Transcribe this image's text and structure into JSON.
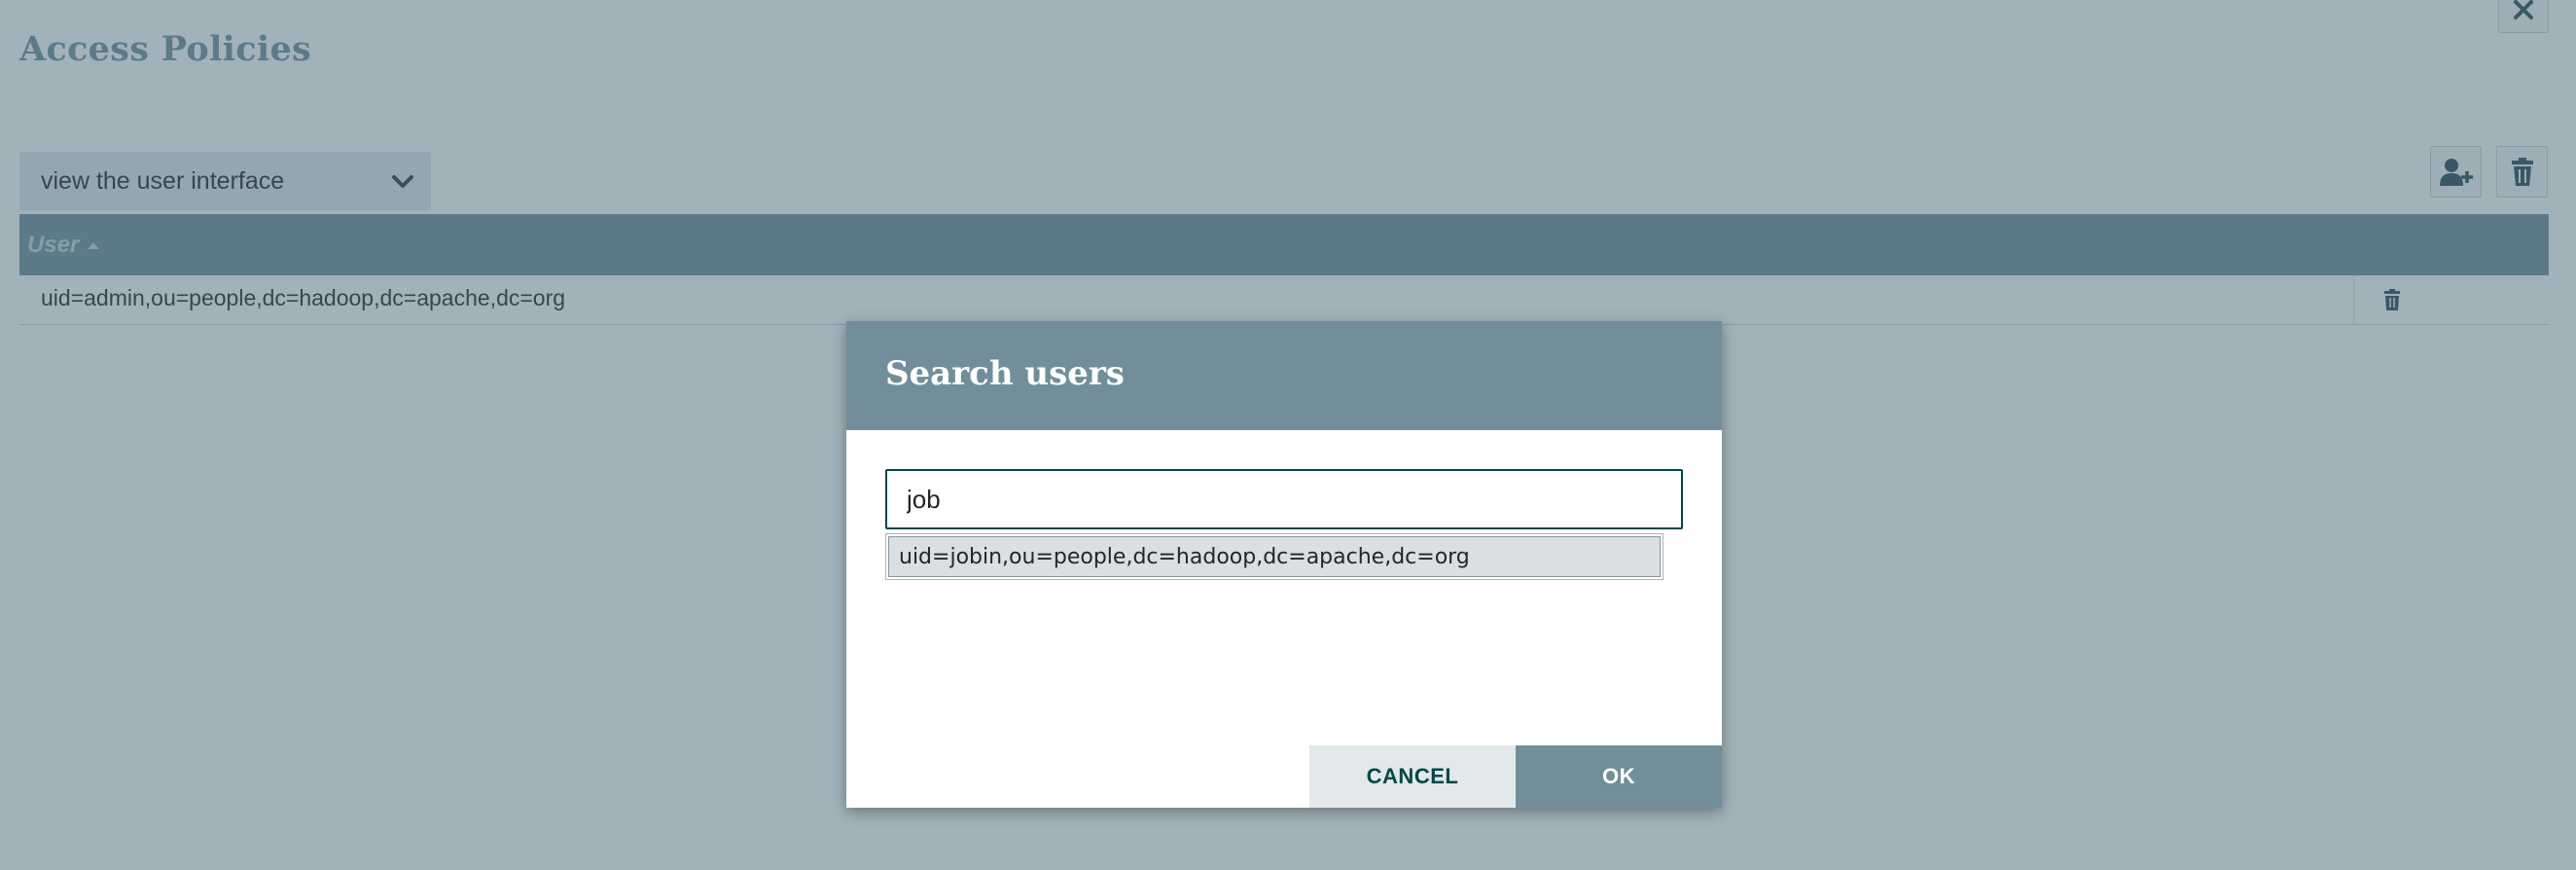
{
  "page": {
    "title": "Access Policies",
    "policy_select": {
      "selected": "view the user interface"
    },
    "table": {
      "columns": [
        {
          "label": "User",
          "sort": "ascending"
        }
      ],
      "rows": [
        {
          "user": "uid=admin,ou=people,dc=hadoop,dc=apache,dc=org"
        }
      ]
    },
    "icons": {
      "close": "close-icon",
      "dropdown": "chevron-down-icon",
      "add_user": "add-user-icon",
      "delete": "trash-icon",
      "sort": "sort-ascending-icon"
    }
  },
  "dialog": {
    "title": "Search users",
    "search_value": "job",
    "suggestions": [
      "uid=jobin,ou=people,dc=hadoop,dc=apache,dc=org"
    ],
    "cancel_label": "CANCEL",
    "ok_label": "OK"
  },
  "colors": {
    "primary": "#728e9b",
    "accent": "#004849",
    "overlay": "#456578",
    "light": "#e3e8eb"
  }
}
